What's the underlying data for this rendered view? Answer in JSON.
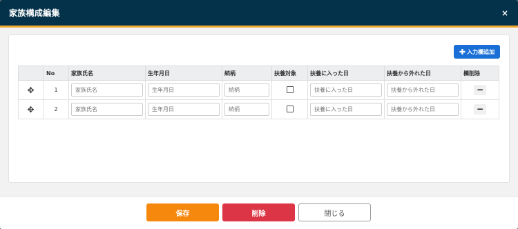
{
  "modal": {
    "title": "家族構成編集",
    "close_glyph": "×"
  },
  "add_button": {
    "icon": "plus-icon",
    "label": "入力欄追加"
  },
  "table": {
    "headers": {
      "no": "No",
      "name": "家族氏名",
      "birthdate": "生年月日",
      "relation": "続柄",
      "dependent": "扶養対象",
      "entered": "扶養に入った日",
      "left": "扶養から外れた日",
      "delete": "欄削除"
    },
    "rows": [
      {
        "no": "1",
        "name_placeholder": "家族氏名",
        "birthdate_placeholder": "生年月日",
        "relation_placeholder": "続柄",
        "entered_placeholder": "扶養に入った日",
        "left_placeholder": "扶養から外れた日"
      },
      {
        "no": "2",
        "name_placeholder": "家族氏名",
        "birthdate_placeholder": "生年月日",
        "relation_placeholder": "続柄",
        "entered_placeholder": "扶養に入った日",
        "left_placeholder": "扶養から外れた日"
      }
    ]
  },
  "footer": {
    "save": "保存",
    "delete": "削除",
    "close": "閉じる"
  },
  "colors": {
    "header_bg": "#04324a",
    "header_accent": "#f0a830",
    "primary": "#1a6fd6",
    "save": "#f7880e",
    "delete": "#dc3545"
  }
}
